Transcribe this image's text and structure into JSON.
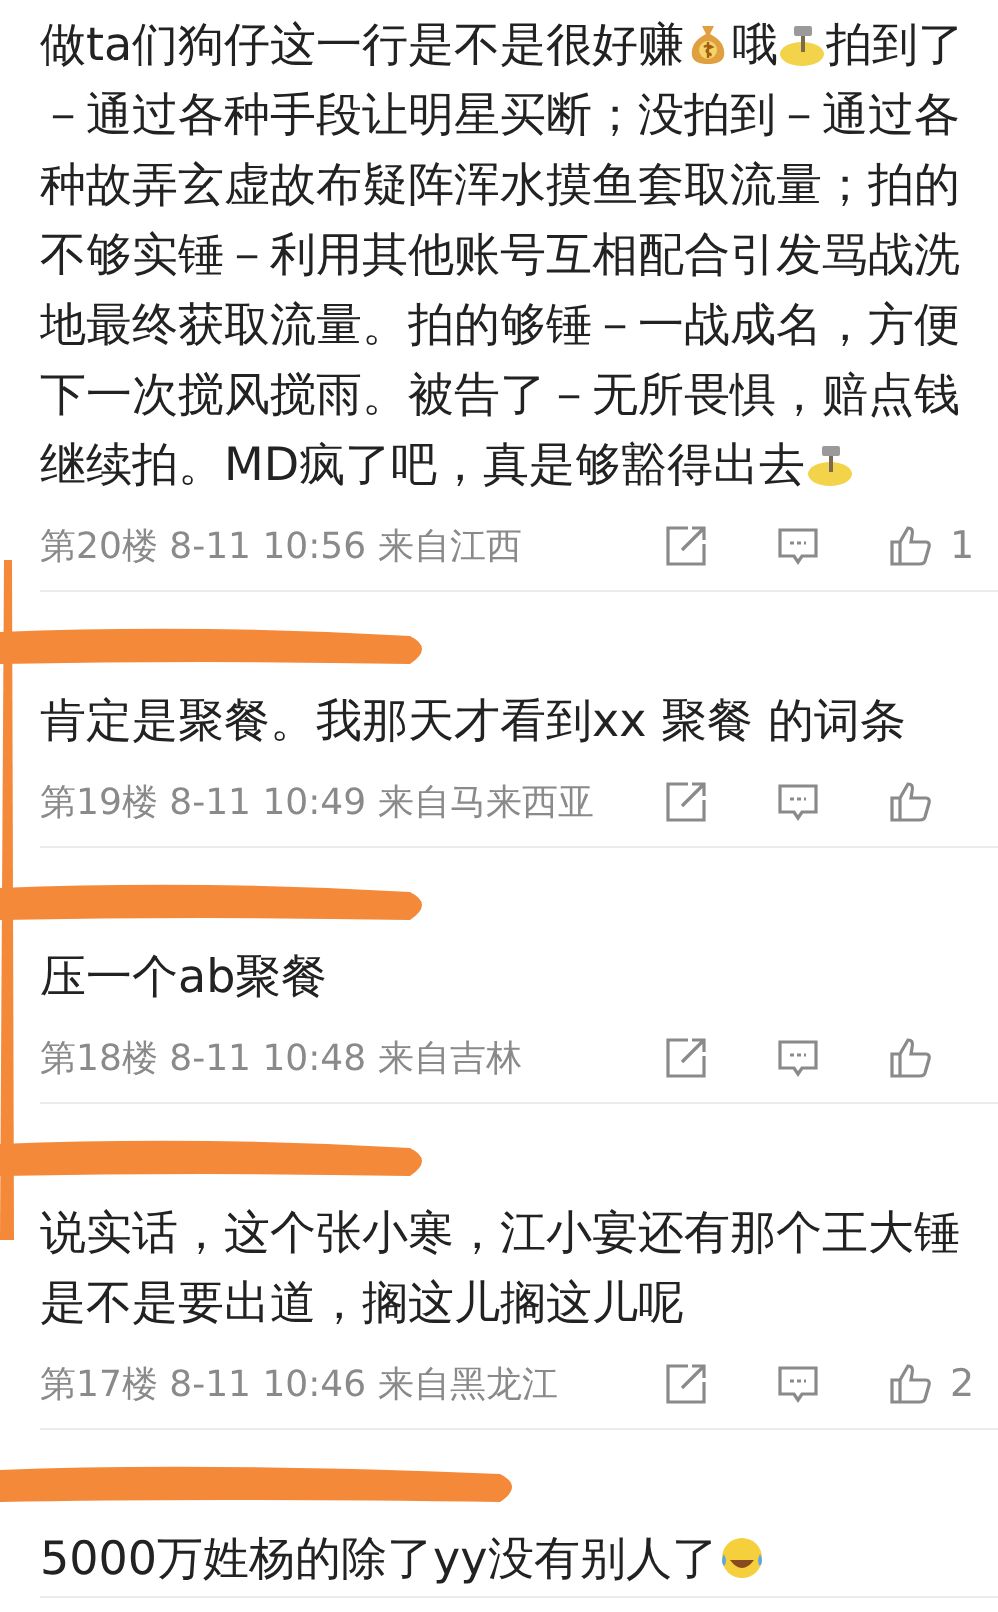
{
  "comments": [
    {
      "name_redacted": false,
      "parts": [
        {
          "kind": "text",
          "text": "做ta们狗仔这一行是不是很好赚"
        },
        {
          "kind": "money"
        },
        {
          "kind": "text",
          "text": "哦"
        },
        {
          "kind": "hammer"
        },
        {
          "kind": "text",
          "text": "拍到了－通过各种手段让明星买断；没拍到－通过各种故弄玄虚故布疑阵浑水摸鱼套取流量；拍的不够实锤－利用其他账号互相配合引发骂战洗地最终获取流量。拍的够锤－一战成名，方便下一次搅风搅雨。被告了－无所畏惧，赔点钱继续拍。MD疯了吧，真是够豁得出去"
        },
        {
          "kind": "hammer"
        }
      ],
      "meta": "第20楼 8-11 10:56 来自江西",
      "likes": "1"
    },
    {
      "name_redacted": true,
      "parts": [
        {
          "kind": "text",
          "text": "肯定是聚餐。我那天才看到xx 聚餐 的词条"
        }
      ],
      "meta": "第19楼 8-11 10:49 来自马来西亚"
    },
    {
      "name_redacted": true,
      "parts": [
        {
          "kind": "text",
          "text": "压一个ab聚餐"
        }
      ],
      "meta": "第18楼 8-11 10:48 来自吉林"
    },
    {
      "name_redacted": true,
      "parts": [
        {
          "kind": "text",
          "text": "说实话，这个张小寒，江小宴还有那个王大锤是不是要出道，搁这儿搁这儿呢"
        }
      ],
      "meta": "第17楼 8-11 10:46 来自黑龙江",
      "likes": "2"
    },
    {
      "name_redacted": true,
      "parts": [
        {
          "kind": "text",
          "text": "5000万姓杨的除了yy没有别人了"
        },
        {
          "kind": "laugh"
        }
      ]
    }
  ]
}
